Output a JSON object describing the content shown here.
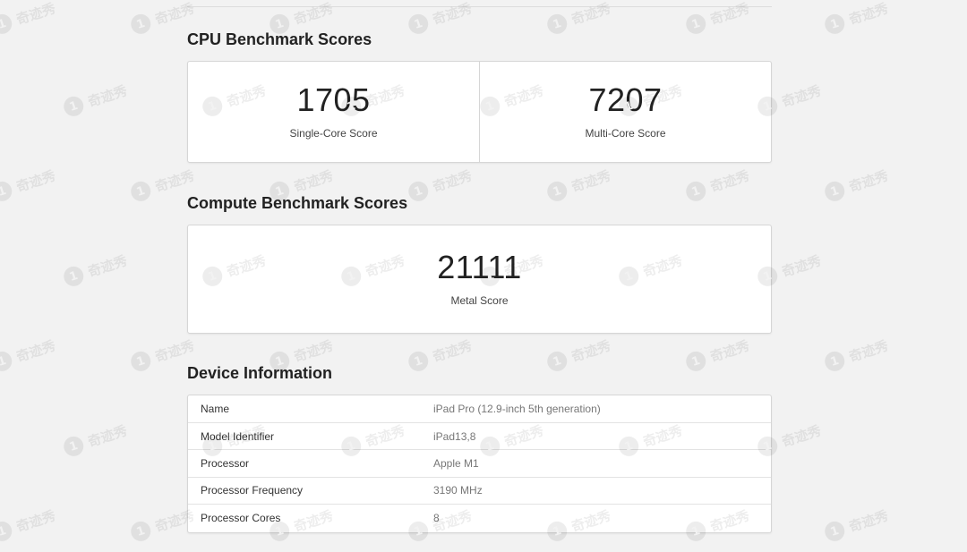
{
  "cpu": {
    "title": "CPU Benchmark Scores",
    "scores": [
      {
        "value": "1705",
        "label": "Single-Core Score"
      },
      {
        "value": "7207",
        "label": "Multi-Core Score"
      }
    ]
  },
  "compute": {
    "title": "Compute Benchmark Scores",
    "score": {
      "value": "21111",
      "label": "Metal Score"
    }
  },
  "device": {
    "title": "Device Information",
    "rows": [
      {
        "key": "Name",
        "value": "iPad Pro (12.9-inch 5th generation)"
      },
      {
        "key": "Model Identifier",
        "value": "iPad13,8"
      },
      {
        "key": "Processor",
        "value": "Apple M1"
      },
      {
        "key": "Processor Frequency",
        "value": "3190 MHz"
      },
      {
        "key": "Processor Cores",
        "value": "8"
      }
    ]
  },
  "watermark": {
    "text": "奇迹秀",
    "logo": "1"
  },
  "colors": {
    "background": "#f2f2f2",
    "card": "#ffffff",
    "border": "#d6d6d6"
  }
}
